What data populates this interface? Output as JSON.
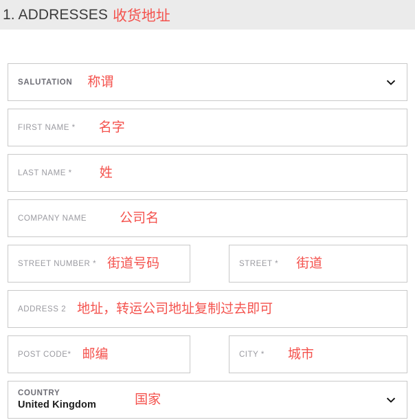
{
  "section": {
    "heading_number": "1.",
    "heading_text": "1. ADDRESSES",
    "heading_annotation": "收货地址"
  },
  "colors": {
    "annotation_red": "#f4524d",
    "header_background": "#ebebeb",
    "field_border": "#c8c8c8",
    "label_gray": "#9a9aa0",
    "label_dark": "#6e6e76"
  },
  "fields": {
    "salutation": {
      "label": "SALUTATION",
      "annotation": "称谓",
      "value": "",
      "icon": "chevron-down-icon"
    },
    "first_name": {
      "label": "FIRST NAME *",
      "annotation": "名字",
      "value": ""
    },
    "last_name": {
      "label": "LAST NAME *",
      "annotation": "姓",
      "value": ""
    },
    "company_name": {
      "label": "COMPANY NAME",
      "annotation": "公司名",
      "value": ""
    },
    "street_number": {
      "label": "STREET NUMBER *",
      "annotation": "街道号码",
      "value": ""
    },
    "street": {
      "label": "STREET *",
      "annotation": "街道",
      "value": ""
    },
    "address2": {
      "label": "ADDRESS 2",
      "annotation": "地址，转运公司地址复制过去即可",
      "value": ""
    },
    "post_code": {
      "label": "POST CODE*",
      "annotation": "邮编",
      "value": ""
    },
    "city": {
      "label": "CITY *",
      "annotation": "城市",
      "value": ""
    },
    "country": {
      "label": "COUNTRY",
      "value": "United Kingdom",
      "annotation": "国家",
      "icon": "chevron-down-icon"
    }
  }
}
